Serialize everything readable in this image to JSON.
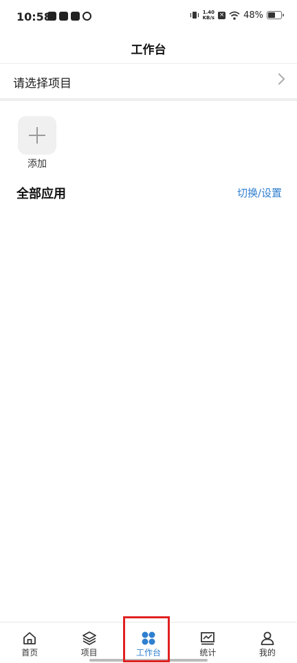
{
  "status_bar": {
    "time": "10:58",
    "net_speed_value": "1.40",
    "net_speed_unit": "KB/s",
    "battery": "48%",
    "battery_level": 0.48,
    "notification_icons": [
      "tiktok-icon",
      "mail-icon",
      "store-icon",
      "app-icon"
    ]
  },
  "header": {
    "title": "工作台"
  },
  "project_selector": {
    "label": "请选择项目"
  },
  "apps": {
    "add_label": "添加"
  },
  "section": {
    "title": "全部应用",
    "switch_label": "切换/设置"
  },
  "bottom_nav": {
    "active_index": 2,
    "active_color": "#2f7fcf",
    "items": [
      {
        "label": "首页",
        "icon": "home-icon"
      },
      {
        "label": "项目",
        "icon": "layers-icon"
      },
      {
        "label": "工作台",
        "icon": "workbench-icon"
      },
      {
        "label": "统计",
        "icon": "chart-icon"
      },
      {
        "label": "我的",
        "icon": "user-icon"
      }
    ]
  }
}
